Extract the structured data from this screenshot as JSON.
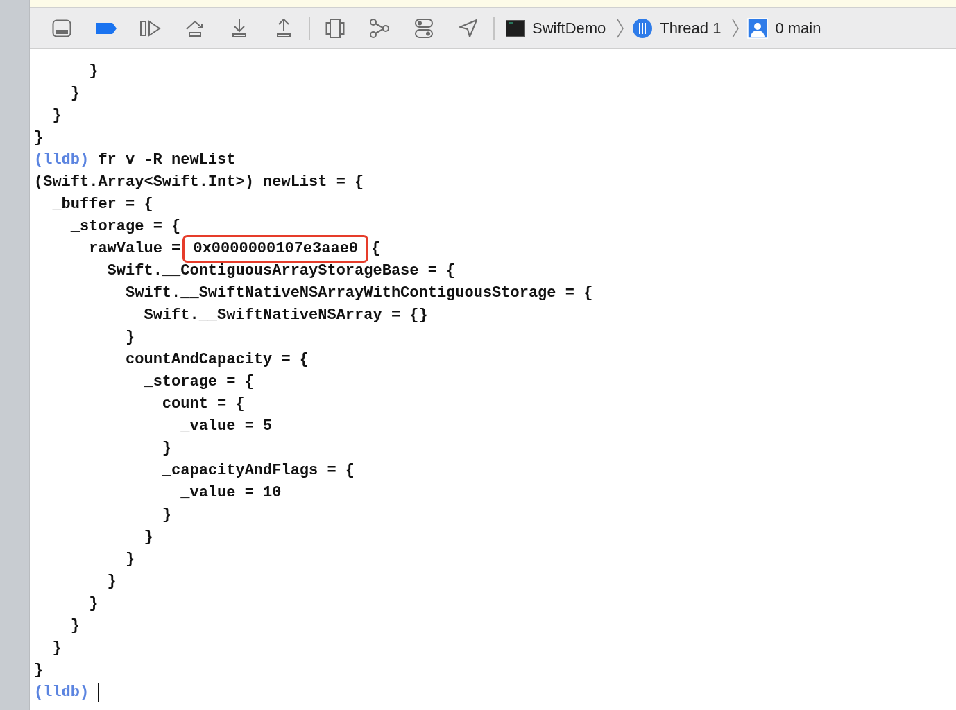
{
  "toolbar": {
    "buttons": [
      {
        "kind": "panel"
      },
      {
        "kind": "breakpoints",
        "on": true
      },
      {
        "kind": "continue"
      },
      {
        "kind": "step-over"
      },
      {
        "kind": "step-into"
      },
      {
        "kind": "step-out",
        "separator_after": true
      },
      {
        "kind": "view-hierarchy"
      },
      {
        "kind": "memory-graph"
      },
      {
        "kind": "environment"
      },
      {
        "kind": "location",
        "separator_after": true
      }
    ],
    "breadcrumbs": [
      {
        "kind": "app",
        "label": "SwiftDemo"
      },
      {
        "kind": "thread",
        "label": "Thread 1"
      },
      {
        "kind": "frame",
        "label": "0 main"
      }
    ]
  },
  "console": {
    "lines": [
      {
        "kind": "output",
        "text": "      }"
      },
      {
        "kind": "output",
        "text": "    }"
      },
      {
        "kind": "output",
        "text": "  }"
      },
      {
        "kind": "output",
        "text": "}"
      },
      {
        "kind": "prompt",
        "prompt": "(lldb)",
        "text": "fr v -R newList"
      },
      {
        "kind": "output",
        "text": "(Swift.Array<Swift.Int>) newList = {"
      },
      {
        "kind": "output",
        "text": "  _buffer = {"
      },
      {
        "kind": "output",
        "text": "    _storage = {"
      },
      {
        "kind": "highlighted",
        "text": "      rawValue = ",
        "highlight": "0x0000000107e3aae0",
        "rest": "{"
      },
      {
        "kind": "output",
        "text": "        Swift.__ContiguousArrayStorageBase = {"
      },
      {
        "kind": "output",
        "text": "          Swift.__SwiftNativeNSArrayWithContiguousStorage = {"
      },
      {
        "kind": "output",
        "text": "            Swift.__SwiftNativeNSArray = {}"
      },
      {
        "kind": "output",
        "text": "          }"
      },
      {
        "kind": "output",
        "text": "          countAndCapacity = {"
      },
      {
        "kind": "output",
        "text": "            _storage = {"
      },
      {
        "kind": "output",
        "text": "              count = {"
      },
      {
        "kind": "output",
        "text": "                _value = 5"
      },
      {
        "kind": "output",
        "text": "              }"
      },
      {
        "kind": "output",
        "text": "              _capacityAndFlags = {"
      },
      {
        "kind": "output",
        "text": "                _value = 10"
      },
      {
        "kind": "output",
        "text": "              }"
      },
      {
        "kind": "output",
        "text": "            }"
      },
      {
        "kind": "output",
        "text": "          }"
      },
      {
        "kind": "output",
        "text": "        }"
      },
      {
        "kind": "output",
        "text": "      }"
      },
      {
        "kind": "output",
        "text": "    }"
      },
      {
        "kind": "output",
        "text": "  }"
      },
      {
        "kind": "output",
        "text": "}"
      },
      {
        "kind": "prompt",
        "prompt": "(lldb)",
        "cursor": true
      }
    ]
  }
}
